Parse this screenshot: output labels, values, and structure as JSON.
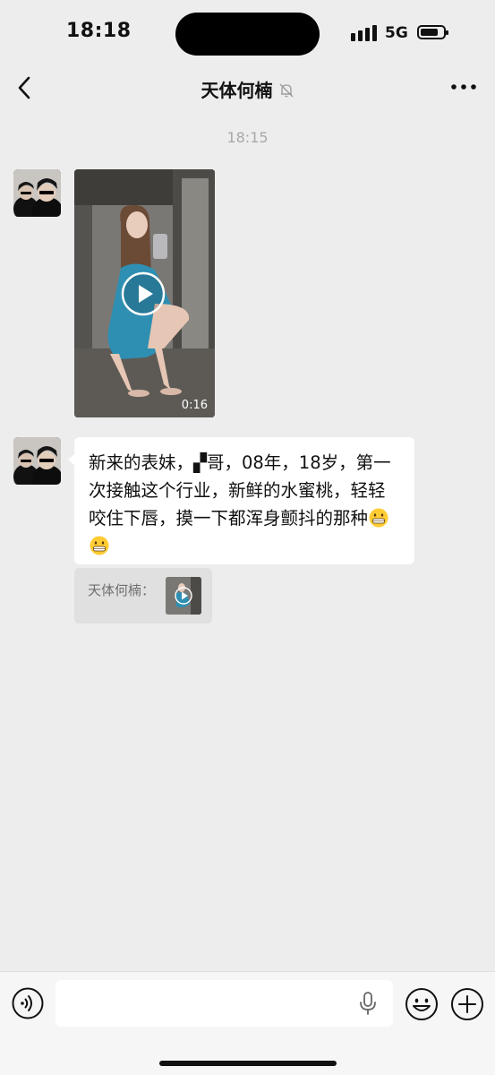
{
  "status": {
    "time": "18:18",
    "network": "5G",
    "battery_level": 0.8
  },
  "header": {
    "title": "天体何楠",
    "muted": true
  },
  "chat": {
    "timestamp": "18:15",
    "video": {
      "duration": "0:16"
    },
    "text_message": "新来的表妹，▞哥，08年，18岁，第一次接触这个行业，新鲜的水蜜桃，轻轻咬住下唇，摸一下都浑身颤抖的那种",
    "quote": {
      "sender": "天体何楠："
    }
  },
  "icons": {
    "back": "chevron-left-icon",
    "mute": "bell-slash-icon",
    "more": "more-dots-icon",
    "play": "play-icon",
    "voice": "voice-icon",
    "mic": "microphone-icon",
    "emoji": "emoji-icon",
    "plus": "plus-icon"
  },
  "colors": {
    "background": "#ededed",
    "bubble": "#ffffff",
    "timestamp": "#a8a8a8",
    "input_bar": "#f6f6f6"
  }
}
